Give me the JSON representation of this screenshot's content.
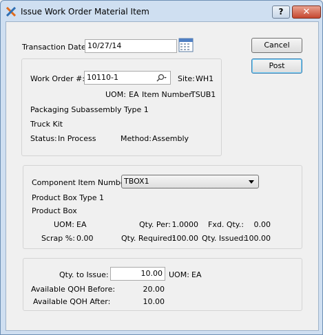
{
  "window": {
    "title": "Issue Work Order Material Item",
    "help_label": "?",
    "close_label": "✕"
  },
  "transaction": {
    "date_label": "Transaction Date:",
    "date_value": "10/27/14"
  },
  "buttons": {
    "cancel": "Cancel",
    "post": "Post"
  },
  "work_order": {
    "label": "Work Order #:",
    "value": "10110-1",
    "site_label": "Site:",
    "site_value": "WH1",
    "uom_label": "UOM:",
    "uom_value": "EA",
    "item_number_label": "Item Number:",
    "item_number_value": "TSUB1",
    "description1": "Packaging Subassembly Type 1",
    "description2": "Truck Kit",
    "status_label": "Status:",
    "status_value": "In Process",
    "method_label": "Method:",
    "method_value": "Assembly"
  },
  "component": {
    "label": "Component Item Number:",
    "selected": "TBOX1",
    "description1": "Product Box Type 1",
    "description2": "Product Box",
    "uom_label": "UOM:",
    "uom_value": "EA",
    "qty_per_label": "Qty. Per:",
    "qty_per_value": "1.0000",
    "fxd_qty_label": "Fxd. Qty.:",
    "fxd_qty_value": "0.00",
    "scrap_label": "Scrap %:",
    "scrap_value": "0.00",
    "qty_required_label": "Qty. Required:",
    "qty_required_value": "100.00",
    "qty_issued_label": "Qty. Issued:",
    "qty_issued_value": "100.00"
  },
  "issue": {
    "qty_label": "Qty. to Issue:",
    "qty_value": "10.00",
    "uom_label": "UOM:",
    "uom_value": "EA",
    "qoh_before_label": "Available QOH Before:",
    "qoh_before_value": "20.00",
    "qoh_after_label": "Available QOH After:",
    "qoh_after_value": "10.00"
  },
  "colors": {
    "titlebar": "#cfdff1",
    "close_button": "#c64830",
    "default_button_border": "#3c7fb1"
  }
}
